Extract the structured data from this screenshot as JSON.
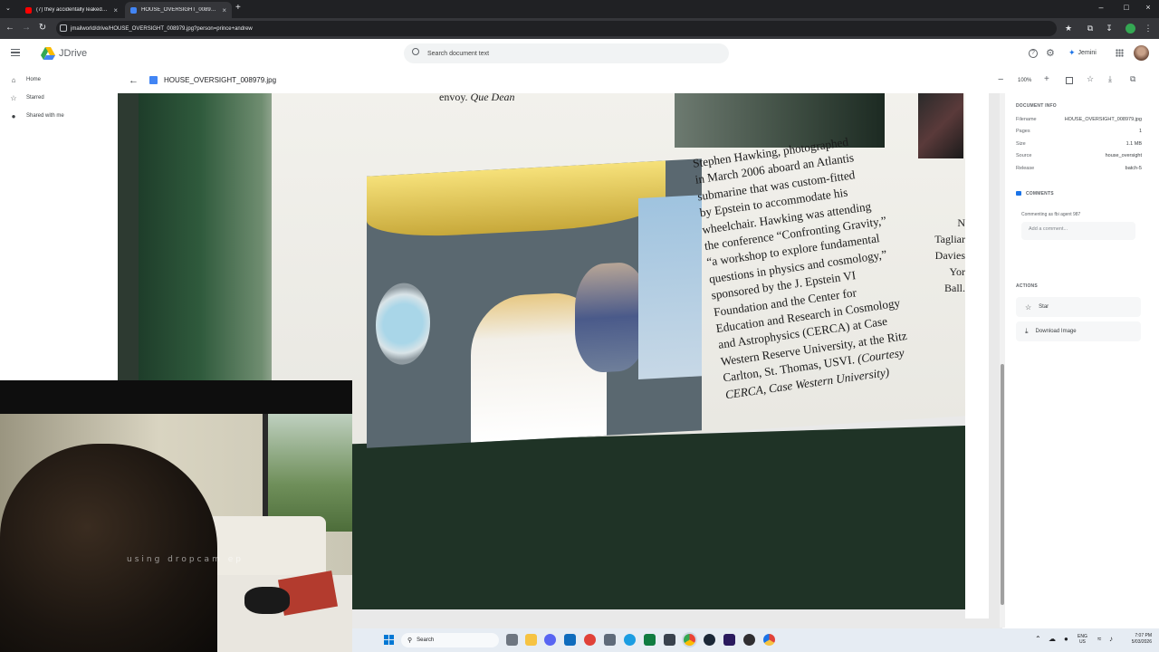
{
  "browser": {
    "tabs": [
      {
        "title": "(7) they accidentally leaked ne",
        "favicon_color": "#ff0000",
        "active": false
      },
      {
        "title": "HOUSE_OVERSIGHT_008979.jpg",
        "favicon_color": "#4285f4",
        "active": true
      }
    ],
    "new_tab_label": "+",
    "url": "jmailworld/drive/HOUSE_OVERSIGHT_008979.jpg?person=prince+andrew"
  },
  "app": {
    "name": "JDrive",
    "search_placeholder": "Search document text",
    "ai_label": "Jemini",
    "file_name": "HOUSE_OVERSIGHT_008979.jpg",
    "zoom": "100%"
  },
  "sidebar": {
    "items": [
      {
        "label": "Home",
        "icon": "home-icon"
      },
      {
        "label": "Starred",
        "icon": "star-icon"
      },
      {
        "label": "Shared with me",
        "icon": "people-icon"
      }
    ]
  },
  "document": {
    "top_fragment": "envoy.",
    "top_fragment_italic": "Que Dean",
    "caption_lines": [
      "Stephen Hawking, photographed",
      "in March 2006 aboard an Atlantis",
      "submarine that was custom-fitted",
      "by Epstein to accommodate his",
      "wheelchair. Hawking was attending",
      "the conference “Confronting Gravity,”",
      "“a workshop to explore fundamental",
      "questions in physics and cosmology,”",
      "sponsored by the J. Epstein VI",
      "Foundation and the Center for",
      "Education and Research in Cosmology",
      "and Astrophysics (CERCA) at Case",
      "Western Reserve University, at the Ritz",
      "Carlton, St. Thomas, USVI.",
      "(Courtesy",
      "CERCA, Case Western University)"
    ],
    "right_edge_lines": [
      "N",
      "Tagliar",
      "Davies",
      "Yor",
      "Ball."
    ]
  },
  "panel": {
    "doc_info_heading": "DOCUMENT INFO",
    "info": [
      {
        "key": "Filename",
        "value": "HOUSE_OVERSIGHT_008979.jpg"
      },
      {
        "key": "Pages",
        "value": "1"
      },
      {
        "key": "Size",
        "value": "1.1 MB"
      },
      {
        "key": "Source",
        "value": "house_oversight"
      },
      {
        "key": "Release",
        "value": "batch-5"
      }
    ],
    "comments_heading": "COMMENTS",
    "commenting_as": "Commenting as fbi agent 987",
    "comment_placeholder": "Add a comment...",
    "actions_heading": "ACTIONS",
    "actions": [
      {
        "label": "Star",
        "icon": "star-outline-icon"
      },
      {
        "label": "Download Image",
        "icon": "download-icon"
      }
    ]
  },
  "webcam": {
    "overlay_text": "using dropcam ep"
  },
  "taskbar": {
    "search_label": "Search",
    "lang_top": "ENG",
    "lang_bottom": "US",
    "time": "7:07 PM",
    "date": "5/03/2026"
  },
  "colors": {
    "accent": "#1a73e8",
    "dark_chrome": "#202124",
    "taskbar": "#e6ecf3"
  }
}
